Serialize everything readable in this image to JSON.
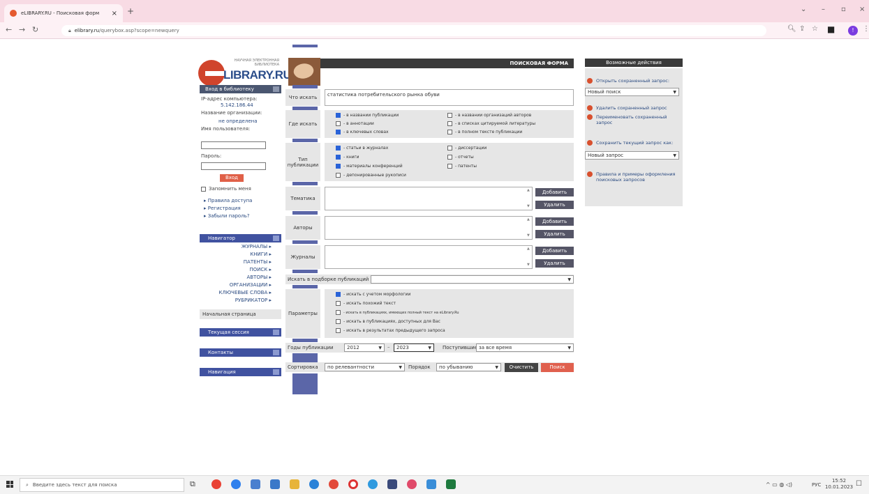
{
  "browser": {
    "tab_title": "eLIBRARY.RU - Поисковая форм",
    "tab_close": "×",
    "new_tab": "+",
    "url_host": "elibrary.ru",
    "url_path": "/querybox.asp?scope=newquery",
    "win_min": "–",
    "win_max": "▫",
    "win_close": "×",
    "win_chevron": "⌄"
  },
  "logo": {
    "small_text": "НАУЧНАЯ ЭЛЕКТРОННАЯ БИБЛИОТЕКА",
    "big_text": "LIBRARY.RU"
  },
  "login": {
    "header": "Вход в библиотеку",
    "ip_label": "IP-адрес компьютера:",
    "ip_value": "5.142.186.44",
    "org_label": "Название организации:",
    "org_value": "не определена",
    "user_label": "Имя пользователя:",
    "password_label": "Пароль:",
    "login_button": "Вход",
    "remember_label": "Запомнить меня",
    "links": [
      "Правила доступа",
      "Регистрация",
      "Забыли пароль?"
    ]
  },
  "navigator": {
    "header": "Навигатор",
    "items": [
      "ЖУРНАЛЫ",
      "КНИГИ",
      "ПАТЕНТЫ",
      "ПОИСК",
      "АВТОРЫ",
      "ОРГАНИЗАЦИИ",
      "КЛЮЧЕВЫЕ СЛОВА",
      "РУБРИКАТОР"
    ],
    "start_page": "Начальная страница"
  },
  "side_sections": [
    "Текущая сессия",
    "Контакты",
    "Навигация"
  ],
  "form": {
    "title": "ПОИСКОВАЯ ФОРМА",
    "what_label": "Что искать",
    "what_value": "статистика потребительского рынка обуви",
    "where_label": "Где искать",
    "where_options": [
      {
        "label": "- в названии публикации",
        "checked": true
      },
      {
        "label": "- в аннотации",
        "checked": false
      },
      {
        "label": "- в ключевых словах",
        "checked": true
      },
      {
        "label": "- в названии организаций авторов",
        "checked": false
      },
      {
        "label": "- в списках цитируемой литературы",
        "checked": false
      },
      {
        "label": "- в полном тексте публикации",
        "checked": false
      }
    ],
    "type_label": "Тип публикации",
    "type_options": [
      {
        "label": "- статьи в журналах",
        "checked": true
      },
      {
        "label": "- книги",
        "checked": true
      },
      {
        "label": "- материалы конференций",
        "checked": true
      },
      {
        "label": "- депонированные рукописи",
        "checked": false
      },
      {
        "label": "- диссертации",
        "checked": false
      },
      {
        "label": "- отчеты",
        "checked": false
      },
      {
        "label": "- патенты",
        "checked": false
      }
    ],
    "topic_label": "Тематика",
    "authors_label": "Авторы",
    "journals_label": "Журналы",
    "add_button": "Добавить",
    "remove_button": "Удалить",
    "collection_label": "Искать в подборке публикаций",
    "params_label": "Параметры",
    "params_options": [
      {
        "label": "- искать с учетом морфологии",
        "checked": true
      },
      {
        "label": "- искать похожий текст",
        "checked": false
      },
      {
        "label": "- искать в публикациях, имеющих полный текст на eLibrary.Ru",
        "checked": false
      },
      {
        "label": "- искать в публикациях, доступных для Вас",
        "checked": false
      },
      {
        "label": "- искать в результатах предыдущего запроса",
        "checked": false
      }
    ],
    "years_label": "Годы публикации",
    "year_from": "2012",
    "year_to": "2023",
    "received_label": "Поступившие",
    "received_value": "за все время",
    "sort_label": "Сортировка",
    "sort_value": "по релевантности",
    "order_label": "Порядок",
    "order_value": "по убыванию",
    "clear_button": "Очистить",
    "search_button": "Поиск"
  },
  "actions": {
    "header": "Возможные действия",
    "open_saved": "Открыть сохраненный запрос:",
    "open_select": "Новый поиск",
    "delete_saved": "Удалить сохраненный запрос",
    "rename_saved": "Переименовать сохраненный запрос",
    "save_as": "Сохранить текущий запрос как:",
    "save_select": "Новый запрос",
    "rules": "Правила и примеры оформления поисковых запросов"
  },
  "taskbar": {
    "search_placeholder": "Введите здесь текст для поиска",
    "lang": "РУС",
    "time": "15:52",
    "date": "10.01.2023"
  },
  "colors": {
    "stripe": "#5b66a8",
    "search_button": "#e0604e",
    "logo_red": "#d0442c",
    "logo_blue": "#2b4d8a"
  }
}
